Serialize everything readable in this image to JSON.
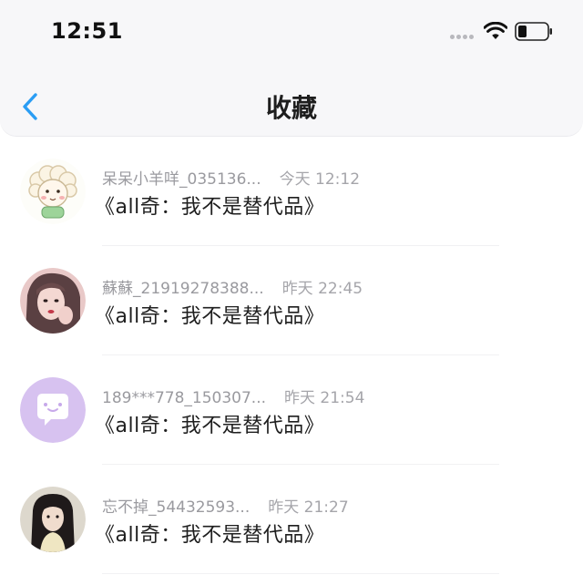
{
  "status_bar": {
    "time": "12:51",
    "signal_icon": "cellular-signal-icon",
    "wifi_icon": "wifi-icon",
    "battery_icon": "battery-icon"
  },
  "nav": {
    "back_icon": "chevron-left-icon",
    "title": "收藏",
    "accent_color": "#2a9df4"
  },
  "items": [
    {
      "username": "呆呆小羊咩_035136...",
      "time": "今天 12:12",
      "title": "《all奇：我不是替代品》",
      "avatar": "sheep-avatar"
    },
    {
      "username": "蘇蘇_21919278388...",
      "time": "昨天 22:45",
      "title": "《all奇：我不是替代品》",
      "avatar": "girl-photo-avatar"
    },
    {
      "username": "189***778_150307...",
      "time": "昨天 21:54",
      "title": "《all奇：我不是替代品》",
      "avatar": "chat-bubble-avatar"
    },
    {
      "username": "忘不掉_54432593...",
      "time": "昨天 21:27",
      "title": "《all奇：我不是替代品》",
      "avatar": "girl-photo-avatar"
    }
  ]
}
